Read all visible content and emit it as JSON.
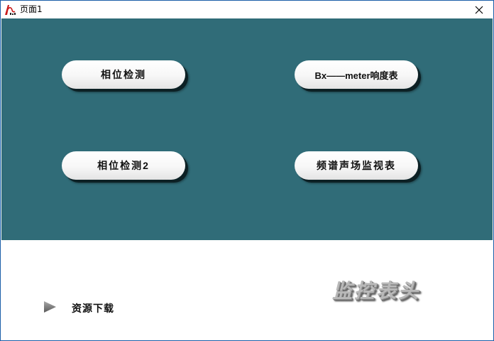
{
  "window": {
    "title": "页面1",
    "icon": "app-logo-icon",
    "close_icon": "close-icon"
  },
  "buttons": {
    "phase_detect": "相位检测",
    "bx_meter": "Bx——meter响度表",
    "phase_detect_2": "相位检测2",
    "spectrum_monitor": "频谱声场监视表"
  },
  "footer": {
    "download_label": "资源下载",
    "download_icon": "play-triangle-icon",
    "brand": "监控表头"
  },
  "colors": {
    "panel": "#306c78",
    "pill": "#ffffff",
    "pill_shadow": "#0c2024",
    "brand": "#b9b9b9",
    "window_border": "#1a5ea8"
  }
}
